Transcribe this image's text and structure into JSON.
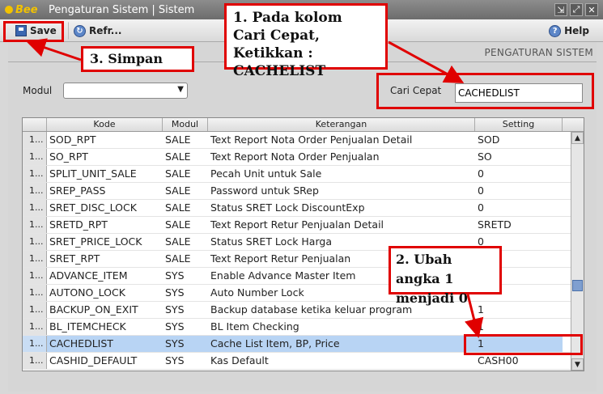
{
  "window": {
    "brand": "Bee",
    "title": "Pengaturan Sistem | Sistem",
    "controls": [
      "⇲",
      "⤢",
      "✕"
    ]
  },
  "toolbar": {
    "save_label": "Save",
    "refresh_label": "Refr...",
    "help_label": "Help"
  },
  "section_title": "PENGATURAN SISTEM",
  "filter": {
    "modul_label": "Modul",
    "modul_value": "",
    "search_label": "Cari Cepat",
    "search_value": "CACHEDLIST"
  },
  "table": {
    "columns": [
      "",
      "Kode",
      "Modul",
      "Keterangan",
      "Setting"
    ],
    "rows": [
      [
        "1...",
        "SOD_RPT",
        "SALE",
        "Text Report Nota Order Penjualan Detail",
        "SOD"
      ],
      [
        "1...",
        "SO_RPT",
        "SALE",
        "Text Report Nota Order Penjualan",
        "SO"
      ],
      [
        "1...",
        "SPLIT_UNIT_SALE",
        "SALE",
        "Pecah Unit untuk Sale",
        "0"
      ],
      [
        "1...",
        "SREP_PASS",
        "SALE",
        "Password untuk SRep",
        "0"
      ],
      [
        "1...",
        "SRET_DISC_LOCK",
        "SALE",
        "Status SRET Lock DiscountExp",
        "0"
      ],
      [
        "1...",
        "SRETD_RPT",
        "SALE",
        "Text Report Retur Penjualan Detail",
        "SRETD"
      ],
      [
        "1...",
        "SRET_PRICE_LOCK",
        "SALE",
        "Status SRET Lock Harga",
        "0"
      ],
      [
        "1...",
        "SRET_RPT",
        "SALE",
        "Text Report Retur Penjualan",
        ""
      ],
      [
        "1...",
        "ADVANCE_ITEM",
        "SYS",
        "Enable Advance Master Item",
        ""
      ],
      [
        "1...",
        "AUTONO_LOCK",
        "SYS",
        "Auto Number Lock",
        ""
      ],
      [
        "1...",
        "BACKUP_ON_EXIT",
        "SYS",
        "Backup database ketika keluar program",
        "1"
      ],
      [
        "1...",
        "BL_ITEMCHECK",
        "SYS",
        "BL Item Checking",
        "1"
      ],
      [
        "1...",
        "CACHEDLIST",
        "SYS",
        "Cache List Item, BP, Price",
        "1"
      ],
      [
        "1...",
        "CASHID_DEFAULT",
        "SYS",
        "Kas Default",
        "CASH00"
      ]
    ],
    "selected_row": 12
  },
  "annotations": {
    "step1": "1. Pada kolom Cari Cepat, Ketikkan : CACHELIST",
    "step2": "2. Ubah angka 1 menjadi 0",
    "step3": "3. Simpan"
  },
  "colors": {
    "highlight": "#e00000",
    "selected_row": "#b8d4f4"
  }
}
